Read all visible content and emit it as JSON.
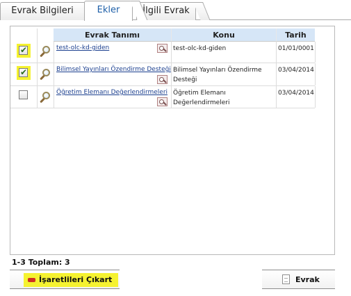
{
  "tabs": [
    {
      "label": "Evrak Bilgileri",
      "active": false
    },
    {
      "label": "Ekler",
      "active": true
    },
    {
      "label": "İlgili Evrak",
      "active": false
    }
  ],
  "table": {
    "columns": [
      "Evrak Tanımı",
      "Konu",
      "Tarih"
    ],
    "rows": [
      {
        "checked": true,
        "name": "test-olc-kd-giden",
        "konu": "test-olc-kd-giden",
        "tarih": "01/01/0001"
      },
      {
        "checked": true,
        "name": "Bilimsel Yayınları Özendirme Desteği",
        "konu": "Bilimsel Yayınları Özendirme Desteği",
        "tarih": "03/04/2014"
      },
      {
        "checked": false,
        "name": "Öğretim Elemanı Değerlendirmeleri",
        "konu": "Öğretim Elemanı Değerlendirmeleri",
        "tarih": "03/04/2014"
      }
    ]
  },
  "footer": {
    "total": "1-3 Toplam: 3",
    "remove_button": "İşaretlileri Çıkart",
    "evrak_button": "Evrak"
  },
  "colors": {
    "header_bg": "#d6e6f7",
    "highlight": "#f5f230",
    "link": "#1b3f8f",
    "active_tab": "#1e5fa8"
  }
}
